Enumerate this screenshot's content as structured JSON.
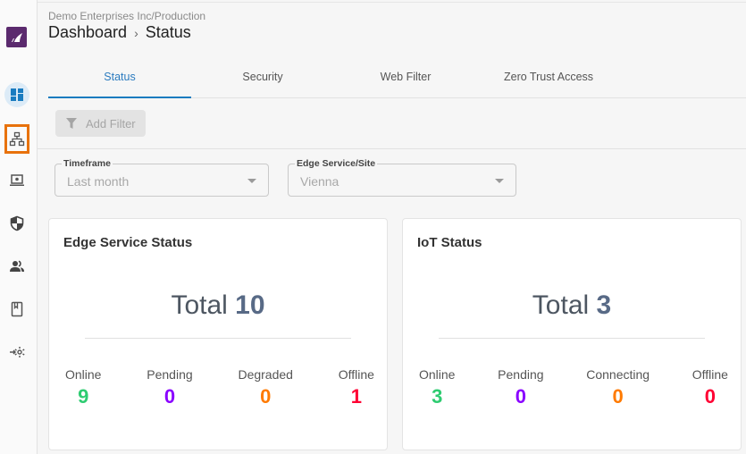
{
  "sidebar": {
    "logo": "brand-logo",
    "items": [
      {
        "name": "dashboard",
        "icon": "dashboard-icon",
        "active": true
      },
      {
        "name": "network",
        "icon": "network-icon",
        "focused": true
      },
      {
        "name": "devices",
        "icon": "laptop-icon"
      },
      {
        "name": "security",
        "icon": "shield-icon"
      },
      {
        "name": "users",
        "icon": "users-icon"
      },
      {
        "name": "docs",
        "icon": "book-icon"
      },
      {
        "name": "integrations",
        "icon": "gear-import-icon"
      }
    ]
  },
  "header": {
    "org": "Demo Enterprises Inc/Production",
    "breadcrumb": [
      "Dashboard",
      "Status"
    ],
    "separator": "›"
  },
  "tabs": [
    {
      "label": "Status",
      "active": true
    },
    {
      "label": "Security"
    },
    {
      "label": "Web Filter"
    },
    {
      "label": "Zero Trust Access"
    }
  ],
  "toolbar": {
    "add_filter_label": "Add Filter"
  },
  "filters": {
    "timeframe": {
      "label": "Timeframe",
      "value": "Last month"
    },
    "site": {
      "label": "Edge Service/Site",
      "value": "Vienna"
    }
  },
  "colors": {
    "online": "#2ecc71",
    "pending": "#8a00ff",
    "degraded": "#ff7a00",
    "offline": "#ff0033",
    "accent": "#1a7cc0"
  },
  "cards": {
    "edge": {
      "title": "Edge Service Status",
      "total_label": "Total",
      "total": "10",
      "stats": [
        {
          "label": "Online",
          "value": "9"
        },
        {
          "label": "Pending",
          "value": "0"
        },
        {
          "label": "Degraded",
          "value": "0"
        },
        {
          "label": "Offline",
          "value": "1"
        }
      ]
    },
    "iot": {
      "title": "IoT Status",
      "total_label": "Total",
      "total": "3",
      "stats": [
        {
          "label": "Online",
          "value": "3"
        },
        {
          "label": "Pending",
          "value": "0"
        },
        {
          "label": "Connecting",
          "value": "0"
        },
        {
          "label": "Offline",
          "value": "0"
        }
      ]
    }
  }
}
